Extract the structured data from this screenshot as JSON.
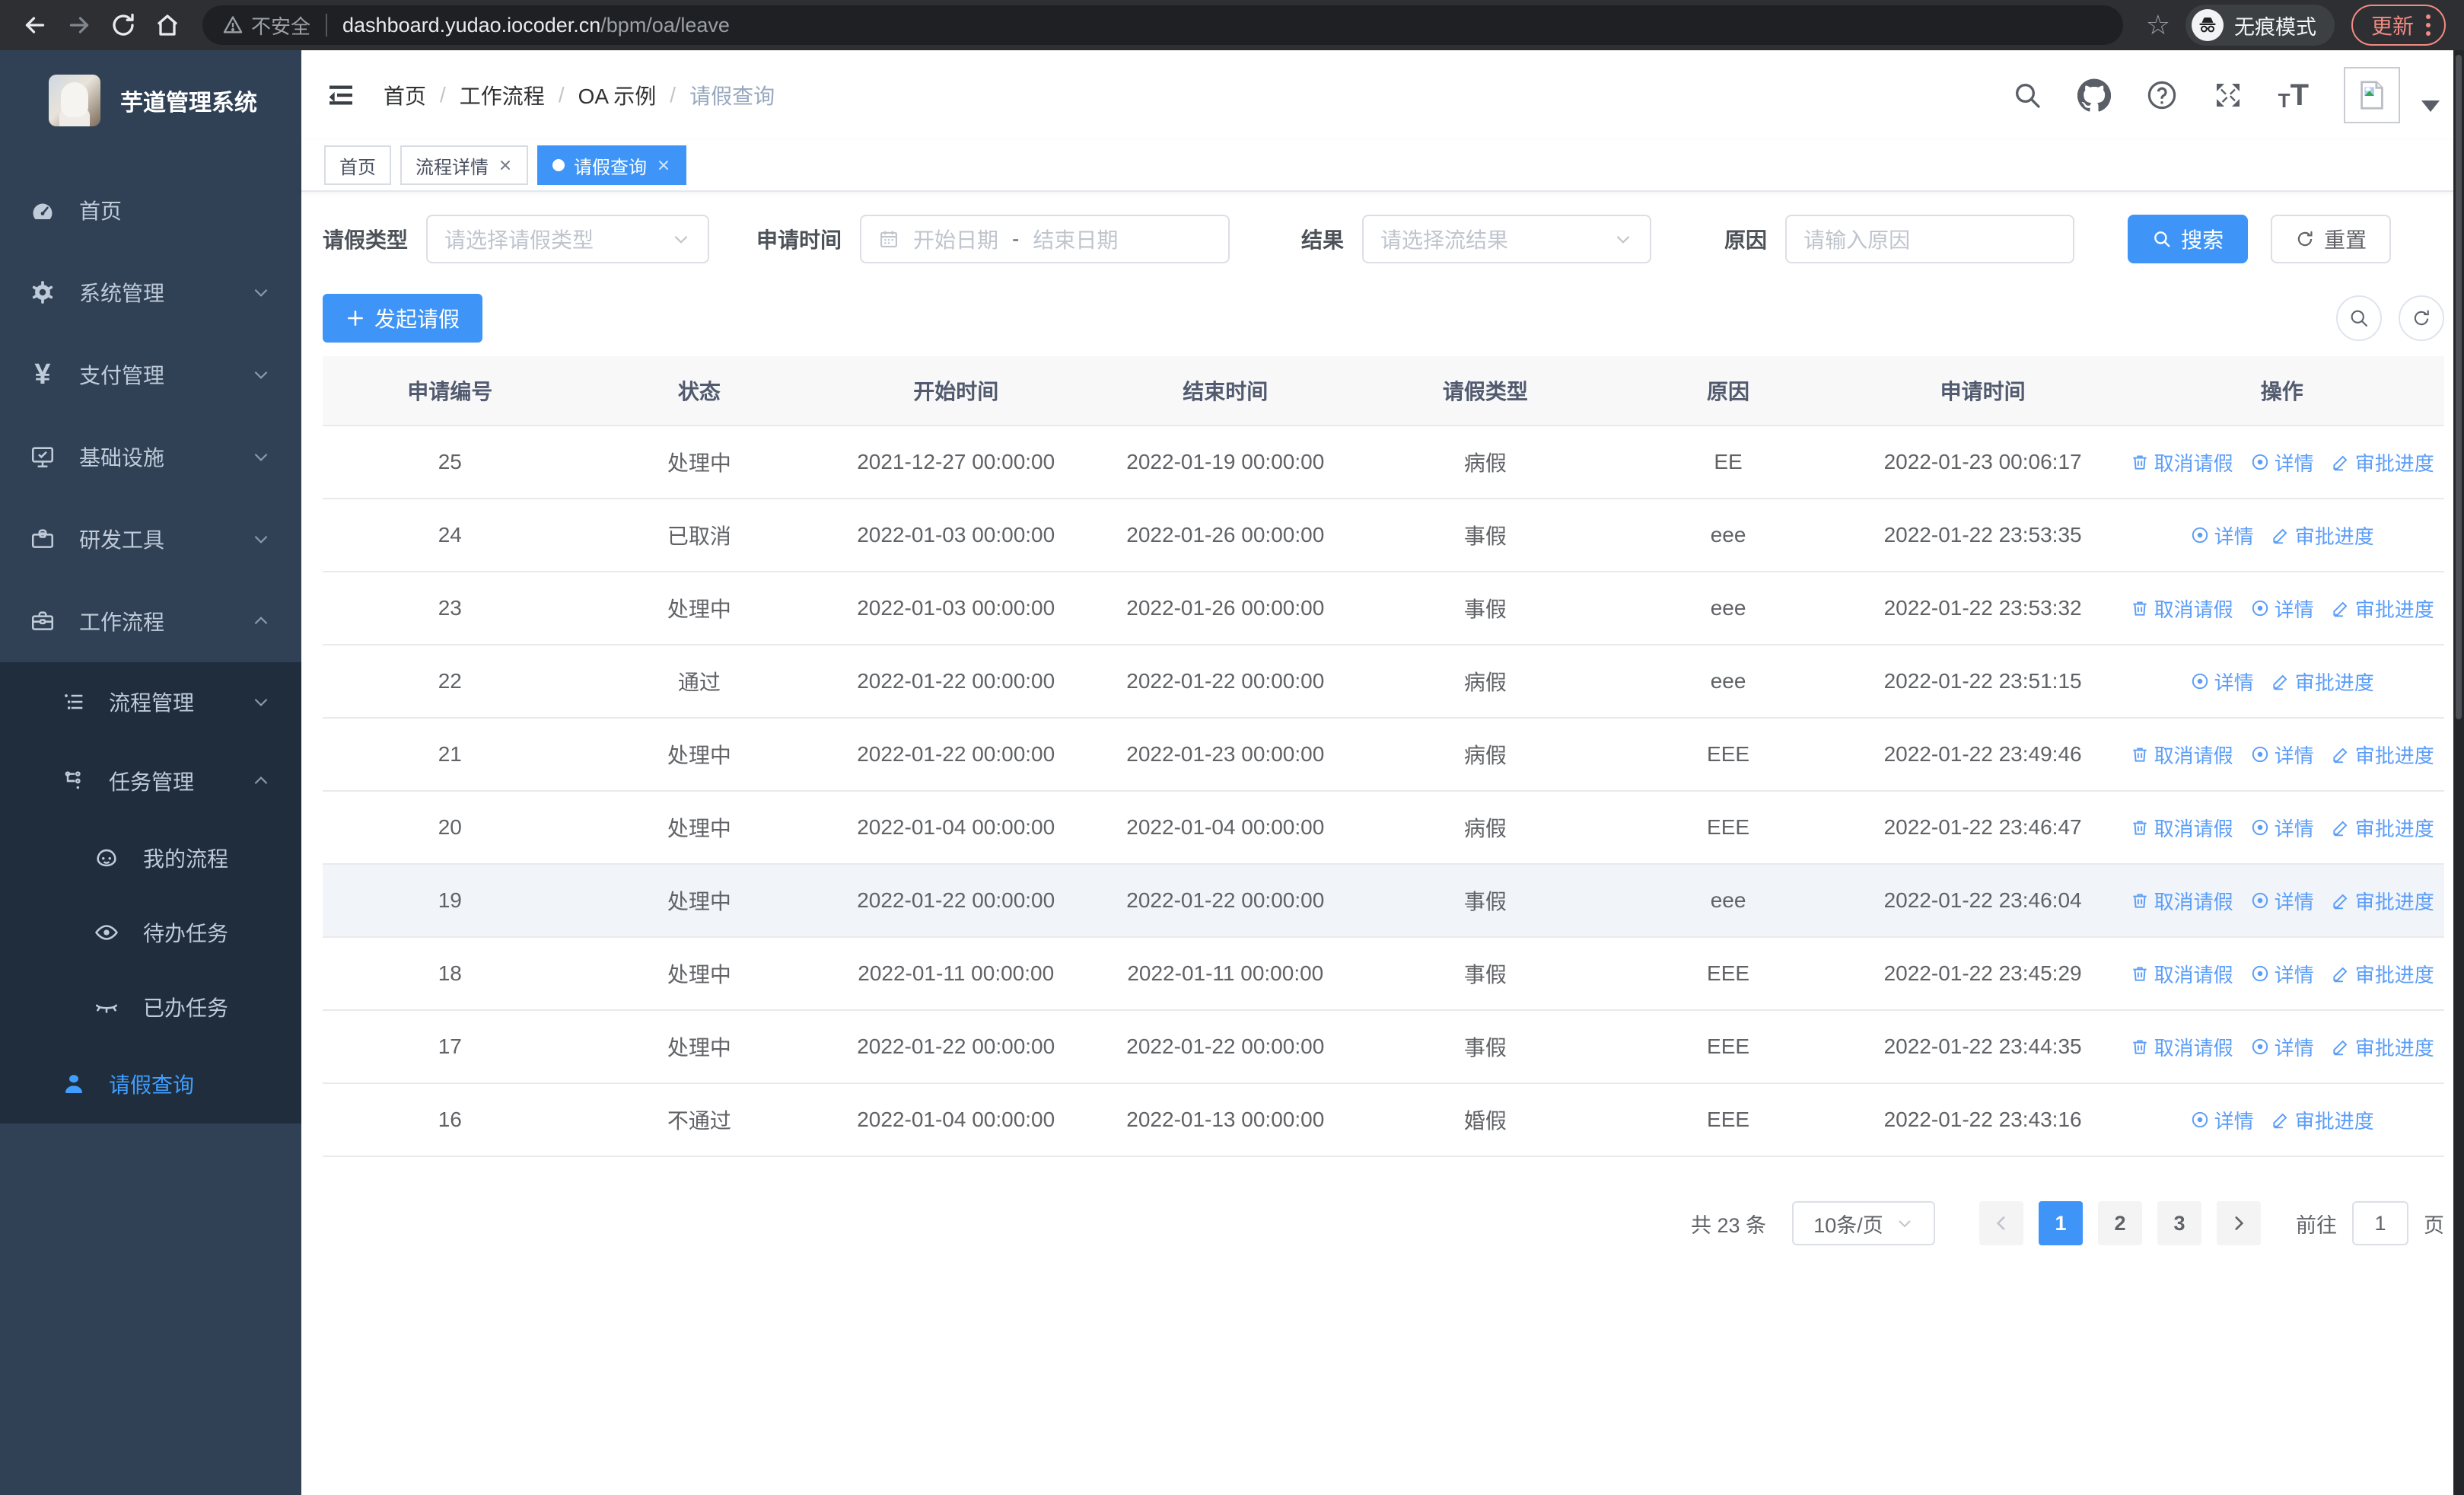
{
  "colors": {
    "accent": "#409eff",
    "sidebar_bg": "#304156",
    "submenu_bg": "#1f2d3d",
    "link": "#5b9df8",
    "update": "#f28b82"
  },
  "browser": {
    "security_label": "不安全",
    "url_host": "dashboard.yudao.iocoder.cn",
    "url_path": "/bpm/oa/leave",
    "incognito_label": "无痕模式",
    "update_label": "更新"
  },
  "sidebar": {
    "title": "芋道管理系统",
    "items": [
      {
        "label": "首页",
        "icon": "dashboard-icon"
      },
      {
        "label": "系统管理",
        "icon": "gear-icon",
        "chevron": "down"
      },
      {
        "label": "支付管理",
        "icon": "yen-icon",
        "chevron": "down"
      },
      {
        "label": "基础设施",
        "icon": "monitor-icon",
        "chevron": "down"
      },
      {
        "label": "研发工具",
        "icon": "toolbox-icon",
        "chevron": "down"
      },
      {
        "label": "工作流程",
        "icon": "briefcase-icon",
        "chevron": "up"
      }
    ],
    "submenu": [
      {
        "label": "流程管理",
        "icon": "tree-icon",
        "chevron": "down"
      },
      {
        "label": "任务管理",
        "icon": "flow-icon",
        "chevron": "up"
      },
      {
        "label": "我的流程",
        "icon": "face-icon"
      },
      {
        "label": "待办任务",
        "icon": "eye-icon"
      },
      {
        "label": "已办任务",
        "icon": "eye-closed-icon"
      },
      {
        "label": "请假查询",
        "icon": "user-icon",
        "active": true
      }
    ]
  },
  "header": {
    "separator": "/",
    "breadcrumb": [
      "首页",
      "工作流程",
      "OA 示例",
      "请假查询"
    ],
    "icons": [
      "search-icon",
      "github-icon",
      "help-icon",
      "fullscreen-icon",
      "font-size-icon",
      "avatar-broken-image",
      "dropdown-caret"
    ]
  },
  "tabs": [
    {
      "label": "首页",
      "closable": false,
      "active": false
    },
    {
      "label": "流程详情",
      "closable": true,
      "active": false
    },
    {
      "label": "请假查询",
      "closable": true,
      "active": true
    }
  ],
  "filters": {
    "leave_type_label": "请假类型",
    "leave_type_placeholder": "请选择请假类型",
    "apply_time_label": "申请时间",
    "date_start_placeholder": "开始日期",
    "date_separator": "-",
    "date_end_placeholder": "结束日期",
    "result_label": "结果",
    "result_placeholder": "请选择流结果",
    "reason_label": "原因",
    "reason_placeholder": "请输入原因",
    "search_label": "搜索",
    "reset_label": "重置"
  },
  "toolbar": {
    "create_label": "发起请假"
  },
  "table": {
    "columns": [
      "申请编号",
      "状态",
      "开始时间",
      "结束时间",
      "请假类型",
      "原因",
      "申请时间",
      "操作"
    ],
    "action_labels": {
      "cancel": "取消请假",
      "detail": "详情",
      "progress": "审批进度"
    },
    "rows": [
      {
        "id": "25",
        "status": "处理中",
        "start": "2021-12-27 00:00:00",
        "end": "2022-01-19 00:00:00",
        "type": "病假",
        "reason": "EE",
        "applyTime": "2022-01-23 00:06:17",
        "cancellable": true,
        "hover": false
      },
      {
        "id": "24",
        "status": "已取消",
        "start": "2022-01-03 00:00:00",
        "end": "2022-01-26 00:00:00",
        "type": "事假",
        "reason": "eee",
        "applyTime": "2022-01-22 23:53:35",
        "cancellable": false,
        "hover": false
      },
      {
        "id": "23",
        "status": "处理中",
        "start": "2022-01-03 00:00:00",
        "end": "2022-01-26 00:00:00",
        "type": "事假",
        "reason": "eee",
        "applyTime": "2022-01-22 23:53:32",
        "cancellable": true,
        "hover": false
      },
      {
        "id": "22",
        "status": "通过",
        "start": "2022-01-22 00:00:00",
        "end": "2022-01-22 00:00:00",
        "type": "病假",
        "reason": "eee",
        "applyTime": "2022-01-22 23:51:15",
        "cancellable": false,
        "hover": false
      },
      {
        "id": "21",
        "status": "处理中",
        "start": "2022-01-22 00:00:00",
        "end": "2022-01-23 00:00:00",
        "type": "病假",
        "reason": "EEE",
        "applyTime": "2022-01-22 23:49:46",
        "cancellable": true,
        "hover": false
      },
      {
        "id": "20",
        "status": "处理中",
        "start": "2022-01-04 00:00:00",
        "end": "2022-01-04 00:00:00",
        "type": "病假",
        "reason": "EEE",
        "applyTime": "2022-01-22 23:46:47",
        "cancellable": true,
        "hover": false
      },
      {
        "id": "19",
        "status": "处理中",
        "start": "2022-01-22 00:00:00",
        "end": "2022-01-22 00:00:00",
        "type": "事假",
        "reason": "eee",
        "applyTime": "2022-01-22 23:46:04",
        "cancellable": true,
        "hover": true
      },
      {
        "id": "18",
        "status": "处理中",
        "start": "2022-01-11 00:00:00",
        "end": "2022-01-11 00:00:00",
        "type": "事假",
        "reason": "EEE",
        "applyTime": "2022-01-22 23:45:29",
        "cancellable": true,
        "hover": false
      },
      {
        "id": "17",
        "status": "处理中",
        "start": "2022-01-22 00:00:00",
        "end": "2022-01-22 00:00:00",
        "type": "事假",
        "reason": "EEE",
        "applyTime": "2022-01-22 23:44:35",
        "cancellable": true,
        "hover": false
      },
      {
        "id": "16",
        "status": "不通过",
        "start": "2022-01-04 00:00:00",
        "end": "2022-01-13 00:00:00",
        "type": "婚假",
        "reason": "EEE",
        "applyTime": "2022-01-22 23:43:16",
        "cancellable": false,
        "hover": false
      }
    ]
  },
  "pagination": {
    "total_label": "共 23 条",
    "page_size": "10条/页",
    "pages": [
      "1",
      "2",
      "3"
    ],
    "active_page": "1",
    "goto_label": "前往",
    "goto_value": "1",
    "page_label": "页"
  }
}
